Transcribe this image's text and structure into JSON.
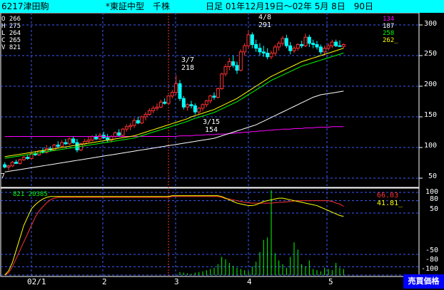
{
  "title": {
    "code": "6217津田駒",
    "market": "*東証中型　千株",
    "period": "日足 01年12月19日～02年 5月 8日　90日"
  },
  "ohlcv": [
    "O 266",
    "H 275",
    "L 264",
    "C 265",
    "V 821"
  ],
  "ma_values": [
    {
      "text": "134",
      "color": "#ff00ff"
    },
    {
      "text": "187",
      "color": "#ffffff"
    },
    {
      "text": "258",
      "color": "#00ff00"
    },
    {
      "text": "262_",
      "color": "#ffff00"
    }
  ],
  "annotations": {
    "high1": "4/8",
    "high1_val": "291",
    "peak": "3/7",
    "peak_val": "218",
    "low": "3/15",
    "low_val": "154",
    "left_edge": "7"
  },
  "osc": {
    "info": "821 20385",
    "val1": "66.03",
    "val1_color": "#ff3333",
    "val2": "41.81_",
    "val2_color": "#ffff00"
  },
  "sell_price_label": "売買価格",
  "chart_data": {
    "type": "candlestick",
    "price_axis": {
      "ticks": [
        300,
        250,
        200,
        150,
        100,
        50
      ],
      "range": [
        40,
        305
      ]
    },
    "osc_axis": {
      "ticks": [
        100,
        80,
        50,
        -50,
        -80,
        -100
      ],
      "range": [
        -100,
        100
      ]
    },
    "x_tick_labels": [
      "02/1",
      "2",
      "3",
      "4",
      "5"
    ],
    "candles": [
      [
        72,
        76,
        66,
        68
      ],
      [
        68,
        72,
        63,
        70
      ],
      [
        70,
        78,
        68,
        76
      ],
      [
        76,
        80,
        73,
        74
      ],
      [
        74,
        82,
        72,
        80
      ],
      [
        80,
        86,
        78,
        84
      ],
      [
        84,
        88,
        80,
        82
      ],
      [
        82,
        92,
        80,
        90
      ],
      [
        90,
        94,
        86,
        88
      ],
      [
        88,
        96,
        86,
        94
      ],
      [
        94,
        100,
        90,
        92
      ],
      [
        92,
        104,
        90,
        98
      ],
      [
        98,
        102,
        94,
        96
      ],
      [
        96,
        106,
        94,
        104
      ],
      [
        104,
        110,
        100,
        102
      ],
      [
        102,
        112,
        100,
        108
      ],
      [
        108,
        114,
        104,
        106
      ],
      [
        106,
        116,
        104,
        114
      ],
      [
        114,
        118,
        106,
        108
      ],
      [
        108,
        114,
        92,
        96
      ],
      [
        96,
        108,
        94,
        106
      ],
      [
        106,
        114,
        104,
        110
      ],
      [
        110,
        118,
        108,
        112
      ],
      [
        112,
        120,
        110,
        118
      ],
      [
        118,
        122,
        112,
        114
      ],
      [
        114,
        124,
        112,
        120
      ],
      [
        120,
        126,
        114,
        116
      ],
      [
        116,
        122,
        108,
        112
      ],
      [
        112,
        120,
        108,
        118
      ],
      [
        118,
        126,
        116,
        124
      ],
      [
        124,
        130,
        118,
        120
      ],
      [
        120,
        132,
        118,
        130
      ],
      [
        130,
        138,
        126,
        134
      ],
      [
        134,
        140,
        128,
        136
      ],
      [
        136,
        148,
        132,
        144
      ],
      [
        144,
        150,
        138,
        140
      ],
      [
        140,
        152,
        138,
        150
      ],
      [
        150,
        158,
        144,
        154
      ],
      [
        154,
        164,
        152,
        160
      ],
      [
        160,
        168,
        156,
        164
      ],
      [
        164,
        172,
        160,
        166
      ],
      [
        166,
        178,
        164,
        174
      ],
      [
        174,
        180,
        170,
        172
      ],
      [
        172,
        186,
        170,
        184
      ],
      [
        184,
        194,
        180,
        190
      ],
      [
        190,
        218,
        186,
        204
      ],
      [
        204,
        210,
        176,
        180
      ],
      [
        180,
        184,
        162,
        166
      ],
      [
        166,
        172,
        160,
        170
      ],
      [
        170,
        176,
        164,
        168
      ],
      [
        168,
        172,
        154,
        158
      ],
      [
        158,
        166,
        154,
        164
      ],
      [
        164,
        172,
        160,
        170
      ],
      [
        170,
        178,
        166,
        176
      ],
      [
        176,
        186,
        172,
        184
      ],
      [
        184,
        190,
        178,
        182
      ],
      [
        182,
        198,
        180,
        196
      ],
      [
        196,
        222,
        194,
        220
      ],
      [
        220,
        236,
        216,
        232
      ],
      [
        232,
        246,
        226,
        240
      ],
      [
        240,
        250,
        230,
        234
      ],
      [
        234,
        240,
        220,
        226
      ],
      [
        226,
        260,
        224,
        256
      ],
      [
        256,
        270,
        250,
        266
      ],
      [
        266,
        291,
        262,
        284
      ],
      [
        284,
        288,
        262,
        268
      ],
      [
        268,
        276,
        256,
        262
      ],
      [
        262,
        270,
        250,
        256
      ],
      [
        256,
        266,
        248,
        254
      ],
      [
        254,
        262,
        244,
        248
      ],
      [
        248,
        258,
        244,
        254
      ],
      [
        254,
        268,
        250,
        264
      ],
      [
        264,
        274,
        258,
        270
      ],
      [
        270,
        282,
        266,
        278
      ],
      [
        278,
        284,
        262,
        266
      ],
      [
        266,
        272,
        252,
        258
      ],
      [
        258,
        266,
        254,
        262
      ],
      [
        262,
        270,
        258,
        268
      ],
      [
        268,
        274,
        262,
        266
      ],
      [
        266,
        286,
        264,
        280
      ],
      [
        280,
        284,
        264,
        270
      ],
      [
        270,
        276,
        262,
        268
      ],
      [
        268,
        274,
        260,
        264
      ],
      [
        264,
        268,
        252,
        256
      ],
      [
        256,
        266,
        250,
        262
      ],
      [
        262,
        270,
        258,
        266
      ],
      [
        266,
        276,
        262,
        272
      ],
      [
        272,
        276,
        264,
        266
      ],
      [
        266,
        275,
        264,
        265
      ],
      [
        265,
        270,
        262,
        268
      ]
    ],
    "ma_short": [
      85,
      86,
      87,
      88,
      89,
      90,
      91,
      92,
      93,
      94,
      95,
      96,
      97,
      98,
      99,
      100,
      101,
      102,
      103,
      104,
      105,
      106,
      107,
      108,
      109,
      110,
      111,
      112,
      113,
      114,
      115,
      116,
      117,
      118,
      119,
      121,
      123,
      125,
      127,
      129,
      131,
      133,
      135,
      137,
      139,
      141,
      143,
      145,
      147,
      150,
      152,
      154,
      156,
      158,
      160,
      162,
      165,
      168,
      171,
      174,
      177,
      180,
      184,
      188,
      192,
      196,
      200,
      204,
      208,
      212,
      216,
      219,
      222,
      225,
      228,
      231,
      234,
      237,
      240,
      242,
      244,
      246,
      248,
      250,
      252,
      254,
      256,
      258,
      260,
      262
    ],
    "ma_mid": [
      60,
      61,
      62,
      63,
      64,
      65,
      66,
      67,
      68,
      69,
      70,
      71,
      72,
      73,
      74,
      75,
      76,
      77,
      78,
      79,
      80,
      81,
      82,
      83,
      84,
      85,
      86,
      87,
      88,
      89,
      90,
      91,
      92,
      93,
      94,
      95,
      96,
      97,
      98,
      99,
      100,
      101,
      102,
      103,
      104,
      105,
      106,
      107,
      108,
      109,
      110,
      111,
      112,
      113,
      114,
      115,
      117,
      119,
      121,
      123,
      125,
      127,
      129,
      131,
      133,
      135,
      137,
      140,
      143,
      146,
      149,
      152,
      155,
      158,
      161,
      164,
      167,
      170,
      173,
      176,
      179,
      182,
      184,
      186,
      187,
      188,
      189,
      190,
      191,
      192
    ],
    "ma_long": [
      118,
      118,
      118,
      118,
      118,
      118,
      118,
      118,
      118,
      118,
      118,
      118,
      118,
      118,
      118,
      118,
      118,
      118,
      118,
      118,
      118,
      118,
      118,
      118,
      118,
      118,
      118,
      118,
      118,
      118,
      118,
      118,
      118,
      118,
      118,
      118,
      118,
      118,
      118,
      118,
      118,
      118,
      118,
      118,
      118,
      118,
      119,
      119,
      119,
      119,
      120,
      120,
      120,
      121,
      121,
      121,
      122,
      122,
      122,
      123,
      123,
      124,
      124,
      125,
      125,
      126,
      126,
      127,
      127,
      128,
      128,
      129,
      129,
      130,
      130,
      130,
      131,
      131,
      131,
      132,
      132,
      132,
      133,
      133,
      133,
      133,
      134,
      134,
      134,
      134
    ],
    "osc_red": [
      -100,
      -95,
      -80,
      -60,
      -40,
      -20,
      0,
      20,
      40,
      55,
      65,
      75,
      82,
      86,
      88,
      88,
      88,
      88,
      88,
      88,
      88,
      88,
      88,
      88,
      88,
      88,
      88,
      88,
      88,
      88,
      88,
      88,
      88,
      88,
      88,
      88,
      88,
      88,
      88,
      88,
      88,
      88,
      88,
      88,
      90,
      90,
      90,
      90,
      90,
      90,
      90,
      90,
      90,
      90,
      90,
      90,
      90,
      88,
      85,
      84,
      82,
      80,
      78,
      76,
      75,
      74,
      74,
      74,
      74,
      74,
      74,
      75,
      76,
      76,
      77,
      78,
      79,
      80,
      80,
      80,
      80,
      80,
      80,
      80,
      80,
      80,
      78,
      74,
      72,
      66
    ],
    "osc_yellow": [
      -100,
      -90,
      -70,
      -40,
      -10,
      20,
      40,
      60,
      70,
      78,
      84,
      88,
      90,
      90,
      90,
      90,
      90,
      90,
      90,
      90,
      90,
      90,
      90,
      90,
      90,
      90,
      90,
      90,
      90,
      90,
      90,
      90,
      90,
      90,
      90,
      90,
      90,
      90,
      90,
      90,
      90,
      90,
      90,
      90,
      92,
      92,
      92,
      92,
      92,
      92,
      92,
      92,
      92,
      92,
      92,
      92,
      92,
      90,
      86,
      82,
      78,
      74,
      72,
      70,
      68,
      68,
      70,
      74,
      78,
      80,
      82,
      84,
      86,
      86,
      84,
      82,
      80,
      78,
      76,
      74,
      72,
      70,
      68,
      64,
      60,
      56,
      52,
      48,
      44,
      42
    ],
    "volume": [
      0,
      0,
      0,
      0,
      0,
      0,
      0,
      0,
      0,
      0,
      0,
      0,
      0,
      0,
      0,
      0,
      0,
      0,
      0,
      0,
      0,
      0,
      0,
      0,
      0,
      0,
      0,
      0,
      0,
      0,
      0,
      0,
      0,
      0,
      0,
      0,
      0,
      0,
      0,
      0,
      0,
      0,
      0,
      0,
      0,
      0,
      5,
      4,
      3,
      2,
      4,
      5,
      6,
      8,
      10,
      12,
      18,
      30,
      26,
      20,
      15,
      12,
      10,
      8,
      6,
      14,
      22,
      38,
      58,
      62,
      140,
      36,
      24,
      18,
      12,
      30,
      54,
      42,
      18,
      14,
      24,
      10,
      8,
      6,
      12,
      10,
      8,
      20,
      12,
      10
    ],
    "vline_index": 43
  }
}
